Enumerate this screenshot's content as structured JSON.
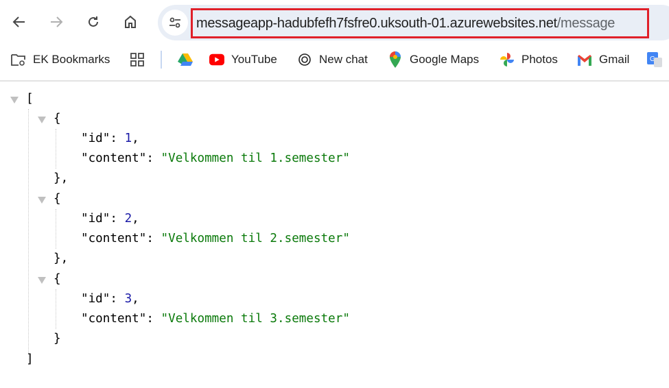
{
  "browser": {
    "url_host": "messageapp-hadubfefh7fsfre0.uksouth-01.azurewebsites.net",
    "url_path": "/message",
    "bookmarks": [
      {
        "label": "EK Bookmarks",
        "icon": "folder-icon"
      },
      {
        "label": "",
        "icon": "apps-grid-icon"
      },
      {
        "label": "",
        "icon": "google-drive-icon"
      },
      {
        "label": "YouTube",
        "icon": "youtube-icon"
      },
      {
        "label": "New chat",
        "icon": "chatgpt-icon"
      },
      {
        "label": "Google Maps",
        "icon": "google-maps-icon"
      },
      {
        "label": "Photos",
        "icon": "google-photos-icon"
      },
      {
        "label": "Gmail",
        "icon": "gmail-icon"
      }
    ]
  },
  "json": {
    "open_bracket": "[",
    "close_bracket": "]",
    "items": [
      {
        "id": "1",
        "content": "\"Velkommen til 1.semester\""
      },
      {
        "id": "2",
        "content": "\"Velkommen til 2.semester\""
      },
      {
        "id": "3",
        "content": "\"Velkommen til 3.semester\""
      }
    ],
    "id_key": "\"id\": ",
    "content_key": "\"content\": "
  },
  "colors": {
    "highlight": "#e0202a",
    "number": "#1a1aa6",
    "string": "#0b7a0b"
  }
}
